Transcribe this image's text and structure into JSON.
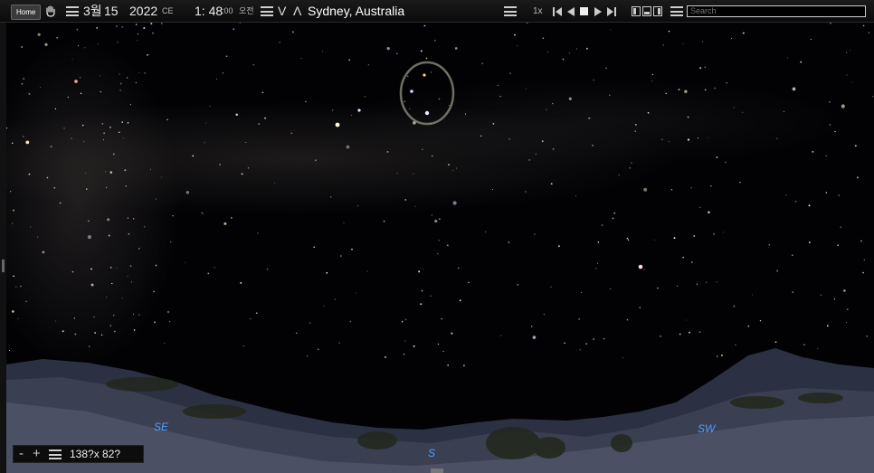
{
  "toolbar": {
    "home_label": "Home",
    "date_month": "3월",
    "date_day": "15",
    "year": "2022",
    "era": "CE",
    "time": "1: 48",
    "seconds": ":00",
    "ampm": "오전",
    "down_symbol": "V",
    "up_symbol": "Λ",
    "location": "Sydney, Australia",
    "speed": "1x",
    "search_placeholder": "Search"
  },
  "horizon_labels": {
    "southeast": "SE",
    "south": "S",
    "southwest": "SW"
  },
  "fov": {
    "minus": "-",
    "plus": "+",
    "value": "138?x 82?"
  },
  "colors": {
    "compass": "#4aa3ff",
    "toolbar_bg": "#111111",
    "sky": "#020205"
  },
  "icons": [
    "hand-icon",
    "menu-icon",
    "step-back-icon",
    "play-back-icon",
    "stop-icon",
    "play-icon",
    "step-forward-icon",
    "view-mode-icon"
  ]
}
